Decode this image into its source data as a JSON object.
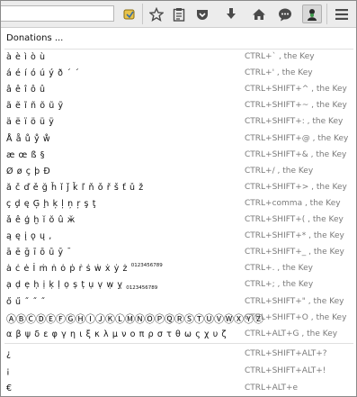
{
  "toolbar": {
    "search_value": "",
    "buttons": [
      "addon-icon",
      "star-icon",
      "clipboard-icon",
      "pocket-icon",
      "download-icon",
      "home-icon",
      "chat-icon",
      "extension-icon",
      "menu-icon"
    ]
  },
  "menu": {
    "header": "Donations ...",
    "items": [
      {
        "chars": "à è ì ò ù",
        "key": "CTRL+` , the Key"
      },
      {
        "chars": "á é í ó ú ý ð ´ ˊ",
        "key": "CTRL+' , the Key"
      },
      {
        "chars": "â ê î ô û",
        "key": "CTRL+SHIFT+^ , the Key"
      },
      {
        "chars": "ã ẽ ĩ ñ õ ũ ỹ",
        "key": "CTRL+SHIFT+~ , the Key"
      },
      {
        "chars": "ä ë ï ö ü ÿ",
        "key": "CTRL+SHIFT+: , the Key"
      },
      {
        "chars": "Å å ů ẙ ẘ",
        "key": "CTRL+SHIFT+@ , the Key"
      },
      {
        "chars": "æ œ ß §",
        "key": "CTRL+SHIFT+& , the Key"
      },
      {
        "chars": "Ø ø ç þ Đ",
        "key": "CTRL+/ , the Key"
      },
      {
        "chars": "ă č ď ě ğ ȟ ǐ ǰ ǩ ľ ň ǒ ř š ť ǔ ž",
        "key": "CTRL+SHIFT+> , the Key"
      },
      {
        "chars": "ç ḑ ę Ģ ḩ ķ ļ ņ ŗ ş ţ",
        "key": "CTRL+comma , the Key"
      },
      {
        "chars": "ǎ ê ģ ḫ ĭ ŏ û ӂ",
        "key": "CTRL+SHIFT+( , the Key"
      },
      {
        "chars": "ą ę į ǫ ų ,",
        "key": "CTRL+SHIFT+* , the Key"
      },
      {
        "chars": "ā ē ḡ ī ō ū ȳ ¯",
        "key": "CTRL+SHIFT+_ , the Key"
      },
      {
        "chars": "ȧ ċ ė İ ṁ ṅ ȯ ṗ ṙ ṡ ẇ ẋ ẏ ż",
        "sup": "0123456789",
        "key": "CTRL+. , the Key"
      },
      {
        "chars": "ạ ḍ ẹ ḥ ị ḳ ḷ ọ ṣ ṭ ụ ṿ ẉ ỵ",
        "sub": "0123456789",
        "key": "CTRL+; , the Key"
      },
      {
        "chars": "ő ű ˝ ˝ ˝",
        "key": "CTRL+SHIFT+\" , the Key"
      },
      {
        "chars": "ⒶⒷⒸⒹⒺⒻⒼⒽⒾⒿⓀⓁⓂⓃⓄⓅⓆⓇⓈⓉⓊⓋⓌⓍⓎⓏ",
        "big": true,
        "key": "CTRL+SHIFT+O , the Key"
      },
      {
        "chars": "α β ψ δ ε φ γ η ι ξ κ λ μ ν ο π ρ σ τ θ ω ς χ υ ζ",
        "key": "CTRL+ALT+G , the Key"
      }
    ],
    "footer_items": [
      {
        "chars": "¿",
        "key": "CTRL+SHIFT+ALT+?"
      },
      {
        "chars": "¡",
        "key": "CTRL+SHIFT+ALT+!"
      },
      {
        "chars": "€",
        "key": "CTRL+ALT+e"
      }
    ]
  }
}
